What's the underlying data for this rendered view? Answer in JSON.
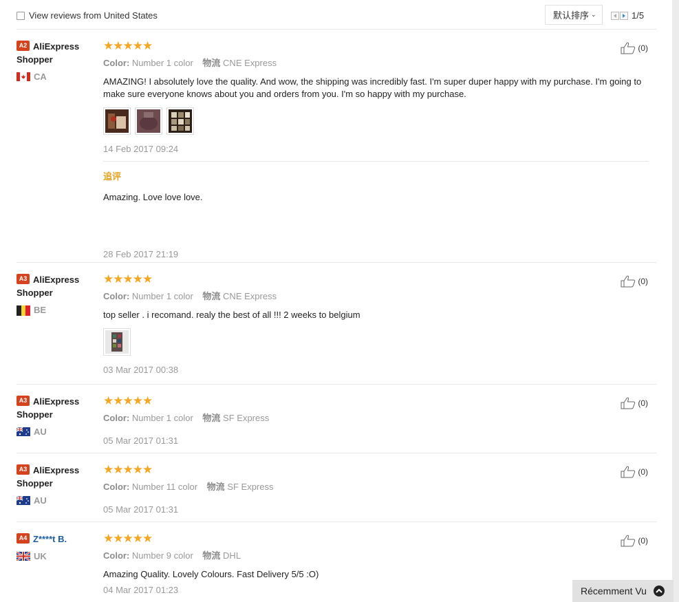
{
  "toolbar": {
    "filter_label": "View reviews from United States",
    "sort_label": "默认排序",
    "page_indicator": "1/5"
  },
  "labels": {
    "color_key": "Color:",
    "shipping_key": "物流",
    "followup_label": "追评"
  },
  "reviews": [
    {
      "level": "A2",
      "name_line1": "AliExpress",
      "name_line2": "Shopper",
      "country": "CA",
      "rating": "★★★★★",
      "color": "Number 1 color",
      "shipping": "CNE Express",
      "text": "AMAZING! I absolutely love the quality. And wow, the shipping was incredibly fast. I'm super duper happy with my purchase. I'm going to make sure everyone knows about you and orders from you. I'm so happy with my purchase.",
      "date": "14 Feb 2017 09:24",
      "followup_text": "Amazing. Love love love.",
      "followup_date": "28 Feb 2017 21:19",
      "helpful": "(0)"
    },
    {
      "level": "A3",
      "name_line1": "AliExpress",
      "name_line2": "Shopper",
      "country": "BE",
      "rating": "★★★★★",
      "color": "Number 1 color",
      "shipping": "CNE Express",
      "text": "top seller . i recomand. realy the best of all !!! 2 weeks to belgium",
      "date": "03 Mar 2017 00:38",
      "helpful": "(0)"
    },
    {
      "level": "A3",
      "name_line1": "AliExpress",
      "name_line2": "Shopper",
      "country": "AU",
      "rating": "★★★★★",
      "color": "Number 1 color",
      "shipping": "SF Express",
      "date": "05 Mar 2017 01:31",
      "helpful": "(0)"
    },
    {
      "level": "A3",
      "name_line1": "AliExpress",
      "name_line2": "Shopper",
      "country": "AU",
      "rating": "★★★★★",
      "color": "Number 11 color",
      "shipping": "SF Express",
      "date": "05 Mar 2017 01:31",
      "helpful": "(0)"
    },
    {
      "level": "A4",
      "name_line1": "Z****t B.",
      "country": "UK",
      "rating": "★★★★★",
      "color": "Number 9 color",
      "shipping": "DHL",
      "text": "Amazing Quality. Lovely Colours. Fast Delivery 5/5 :O)",
      "date": "04 Mar 2017 01:23",
      "helpful": "(0)"
    }
  ],
  "recently_viewed": "Récemment Vu",
  "icons": {
    "thumbs_up": "thumbs-up-icon",
    "star": "star-icon",
    "scroll_up": "chevron-up-icon"
  },
  "colors": {
    "star": "#f5a623",
    "level_badge": "#d5431e",
    "followup": "#e6a11f",
    "link_blue": "#1a5ea0"
  }
}
